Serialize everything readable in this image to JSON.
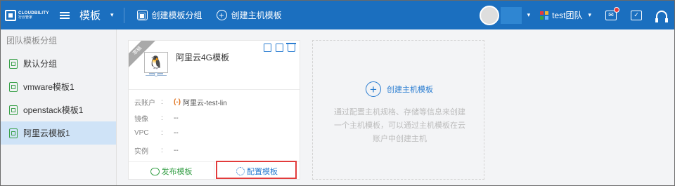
{
  "brand": {
    "name_en": "CLOUDBILITY",
    "name_cn": "行云管家"
  },
  "header": {
    "title": "模板",
    "create_group_label": "创建模板分组",
    "create_host_template_label": "创建主机模板",
    "team_label": "test团队"
  },
  "sidebar": {
    "header": "团队模板分组",
    "items": [
      {
        "label": "默认分组",
        "active": false
      },
      {
        "label": "vmware模板1",
        "active": false
      },
      {
        "label": "openstack模板1",
        "active": false
      },
      {
        "label": "阿里云模板1",
        "active": true
      }
    ]
  },
  "card": {
    "ribbon": "草稿",
    "os_icon": "linux-penguin",
    "name": "阿里云4G模板",
    "fields": [
      {
        "key": "云账户",
        "value": "阿里云-test-lin"
      },
      {
        "key": "镜像",
        "value": "--"
      },
      {
        "key": "VPC",
        "value": "--"
      },
      {
        "key": "实例",
        "value": "--"
      }
    ],
    "colon": ":",
    "cloud_icon_text": "(-)",
    "publish_label": "发布模板",
    "config_label": "配置模板"
  },
  "create_panel": {
    "button_label": "创建主机模板",
    "description": "通过配置主机规格、存储等信息来创建一个主机模板，可以通过主机模板在云账户中创建主机"
  },
  "colors": {
    "topbar": "#1b6fbf",
    "accent": "#2a7dd1",
    "green": "#3aa14a",
    "highlight": "#e23b3b",
    "active_item": "#cfe3f7"
  }
}
